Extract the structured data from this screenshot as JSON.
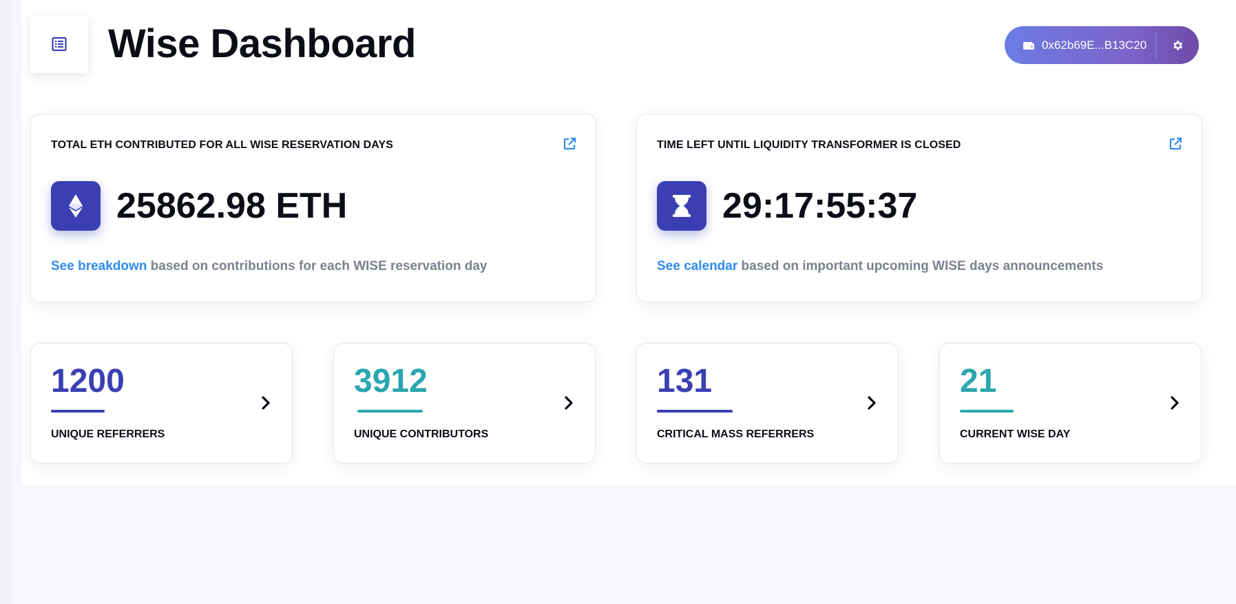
{
  "header": {
    "title": "Wise Dashboard",
    "menu_icon": "list-icon",
    "wallet": {
      "address": "0x62b69E...B13C20",
      "wallet_icon": "wallet-icon",
      "settings_icon": "gear-icon"
    }
  },
  "cards": [
    {
      "heading": "TOTAL ETH CONTRIBUTED FOR ALL WISE RESERVATION DAYS",
      "icon": "ethereum-icon",
      "value": "25862.98 ETH",
      "link_text": "See breakdown",
      "footer_text": " based on contributions for each WISE reservation day"
    },
    {
      "heading": "TIME LEFT UNTIL LIQUIDITY TRANSFORMER IS CLOSED",
      "icon": "hourglass-icon",
      "value": "29:17:55:37",
      "link_text": "See calendar",
      "footer_text": " based on important upcoming WISE days announcements"
    }
  ],
  "stats": [
    {
      "value": "1200",
      "label": "UNIQUE REFERRERS",
      "color": "#3b3fb3"
    },
    {
      "value": "3912",
      "label": "UNIQUE CONTRIBUTORS",
      "color": "#2aa6b0"
    },
    {
      "value": "131",
      "label": "CRITICAL MASS REFERRERS",
      "color": "#3b3fb3"
    },
    {
      "value": "21",
      "label": "CURRENT WISE DAY",
      "color": "#2aa6b0"
    }
  ],
  "colors": {
    "primary": "#3b3fb3",
    "accent": "#2aa6b0",
    "link": "#2f8cf0",
    "muted_text": "#7c8190"
  }
}
